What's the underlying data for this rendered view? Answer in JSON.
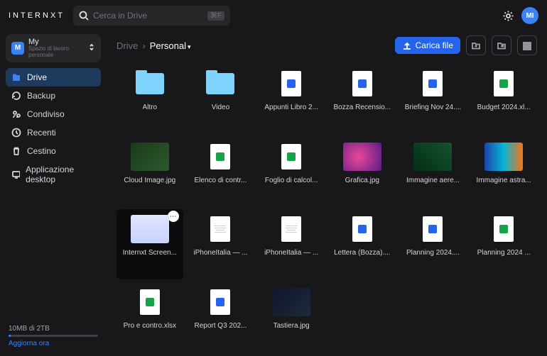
{
  "brand": "INTERNXT",
  "search": {
    "placeholder": "Cerca in Drive",
    "shortcut": "⌘F"
  },
  "user": {
    "initials": "MI"
  },
  "workspace": {
    "badge": "M",
    "name": "My",
    "subtitle": "Spazio di lavoro personale"
  },
  "sidebar": [
    {
      "icon": "folder",
      "label": "Drive",
      "active": true
    },
    {
      "icon": "backup",
      "label": "Backup"
    },
    {
      "icon": "shared",
      "label": "Condiviso"
    },
    {
      "icon": "recent",
      "label": "Recenti"
    },
    {
      "icon": "trash",
      "label": "Cestino"
    },
    {
      "icon": "desktop",
      "label": "Applicazione desktop"
    }
  ],
  "storage": {
    "text": "10MB di 2TB",
    "upgrade": "Aggiorna ora"
  },
  "breadcrumb": {
    "root": "Drive",
    "current": "Personal"
  },
  "upload": "Carica file",
  "items": [
    {
      "type": "folder",
      "name": "Altro"
    },
    {
      "type": "folder",
      "name": "Video"
    },
    {
      "type": "word",
      "name": "Appunti Libro 2..."
    },
    {
      "type": "word",
      "name": "Bozza Recensio..."
    },
    {
      "type": "word",
      "name": "Briefing Nov 24...."
    },
    {
      "type": "excel",
      "name": "Budget 2024.xl..."
    },
    {
      "type": "img",
      "name": "Cloud Image.jpg",
      "bg": "linear-gradient(135deg,#1a3a1a,#2d5a2d)"
    },
    {
      "type": "excel",
      "name": "Elenco di contr..."
    },
    {
      "type": "excel",
      "name": "Foglio di calcol..."
    },
    {
      "type": "img",
      "name": "Grafica.jpg",
      "bg": "radial-gradient(circle at 40% 50%,#ec4899,#581c87)"
    },
    {
      "type": "img",
      "name": "Immagine aere...",
      "bg": "linear-gradient(45deg,#052e16,#14532d)"
    },
    {
      "type": "img",
      "name": "Immagine astra...",
      "bg": "linear-gradient(90deg,#1e40af,#06b6d4,#f97316)"
    },
    {
      "type": "img",
      "name": "Internxt Screen...",
      "bg": "linear-gradient(180deg,#e0e7ff,#c7d2fe)",
      "sel": true
    },
    {
      "type": "page",
      "name": "iPhoneItalia — ..."
    },
    {
      "type": "page",
      "name": "iPhoneItalia — ..."
    },
    {
      "type": "word",
      "name": "Lettera (Bozza)...."
    },
    {
      "type": "word",
      "name": "Planning 2024...."
    },
    {
      "type": "excel",
      "name": "Planning 2024 ..."
    },
    {
      "type": "excel",
      "name": "Pro e contro.xlsx"
    },
    {
      "type": "word",
      "name": "Report Q3 202..."
    },
    {
      "type": "img",
      "name": "Tastiera.jpg",
      "bg": "linear-gradient(135deg,#0f172a,#1e293b)"
    }
  ]
}
